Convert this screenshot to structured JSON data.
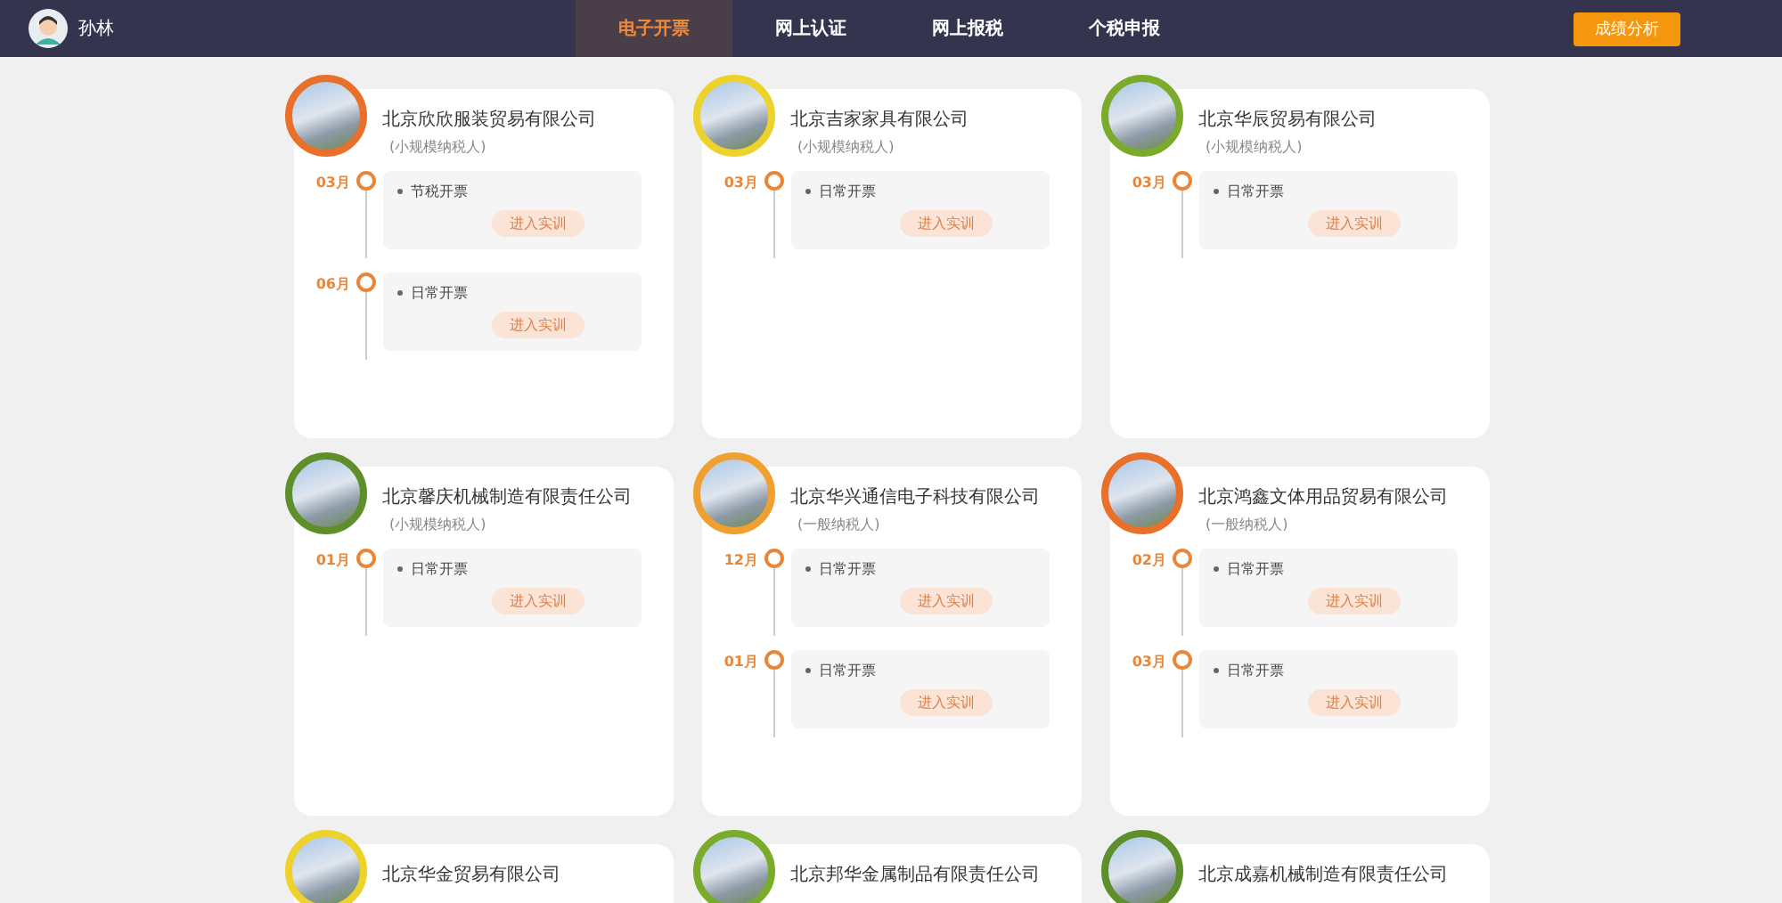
{
  "header": {
    "user": "孙林",
    "nav": [
      {
        "label": "电子开票",
        "selected": true
      },
      {
        "label": "网上认证",
        "selected": false
      },
      {
        "label": "网上报税",
        "selected": false
      },
      {
        "label": "个税申报",
        "selected": false
      }
    ],
    "action": "成绩分析"
  },
  "companies": [
    {
      "name": "北京欣欣服装贸易有限公司",
      "type": "(小规模纳税人)",
      "color": "#e8702a",
      "entries": [
        {
          "month": "03月",
          "task": "节税开票",
          "button": "进入实训"
        },
        {
          "month": "06月",
          "task": "日常开票",
          "button": "进入实训"
        }
      ]
    },
    {
      "name": "北京吉家家具有限公司",
      "type": "(小规模纳税人)",
      "color": "#ecd22a",
      "entries": [
        {
          "month": "03月",
          "task": "日常开票",
          "button": "进入实训"
        }
      ]
    },
    {
      "name": "北京华辰贸易有限公司",
      "type": "(小规模纳税人)",
      "color": "#7aab2a",
      "entries": [
        {
          "month": "03月",
          "task": "日常开票",
          "button": "进入实训"
        }
      ]
    },
    {
      "name": "北京馨庆机械制造有限责任公司",
      "type": "(小规模纳税人)",
      "color": "#5f8f2a",
      "entries": [
        {
          "month": "01月",
          "task": "日常开票",
          "button": "进入实训"
        }
      ]
    },
    {
      "name": "北京华兴通信电子科技有限公司",
      "type": "(一般纳税人)",
      "color": "#f0a030",
      "entries": [
        {
          "month": "12月",
          "task": "日常开票",
          "button": "进入实训"
        },
        {
          "month": "01月",
          "task": "日常开票",
          "button": "进入实训"
        }
      ]
    },
    {
      "name": "北京鸿鑫文体用品贸易有限公司",
      "type": "(一般纳税人)",
      "color": "#e8702a",
      "entries": [
        {
          "month": "02月",
          "task": "日常开票",
          "button": "进入实训"
        },
        {
          "month": "03月",
          "task": "日常开票",
          "button": "进入实训"
        }
      ]
    },
    {
      "name": "北京华金贸易有限公司",
      "color": "#ecd22a"
    },
    {
      "name": "北京邦华金属制品有限责任公司",
      "color": "#7aab2a"
    },
    {
      "name": "北京成嘉机械制造有限责任公司",
      "color": "#5f8f2a"
    }
  ]
}
